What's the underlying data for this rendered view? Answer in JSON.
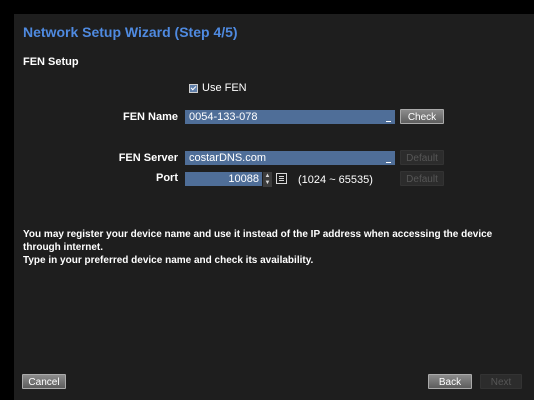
{
  "wizard": {
    "title": "Network Setup Wizard (Step 4/5)",
    "section_title": "FEN Setup",
    "use_fen": {
      "label": "Use FEN",
      "checked": true
    },
    "fen_name": {
      "label": "FEN Name",
      "value": "0054-133-078",
      "check_label": "Check"
    },
    "fen_server": {
      "label": "FEN Server",
      "value": "costarDNS.com",
      "default_label": "Default"
    },
    "port": {
      "label": "Port",
      "value": "10088",
      "range": "(1024 ~ 65535)",
      "default_label": "Default"
    },
    "description_line1": "You may register your device name and use it instead of the IP address when accessing the device through internet.",
    "description_line2": "Type in your preferred device name and check its availability.",
    "buttons": {
      "cancel": "Cancel",
      "back": "Back",
      "next": "Next"
    }
  },
  "colors": {
    "title": "#4f8ae0",
    "input_bg": "#4f6e98",
    "panel_bg": "#1e1e1e"
  }
}
